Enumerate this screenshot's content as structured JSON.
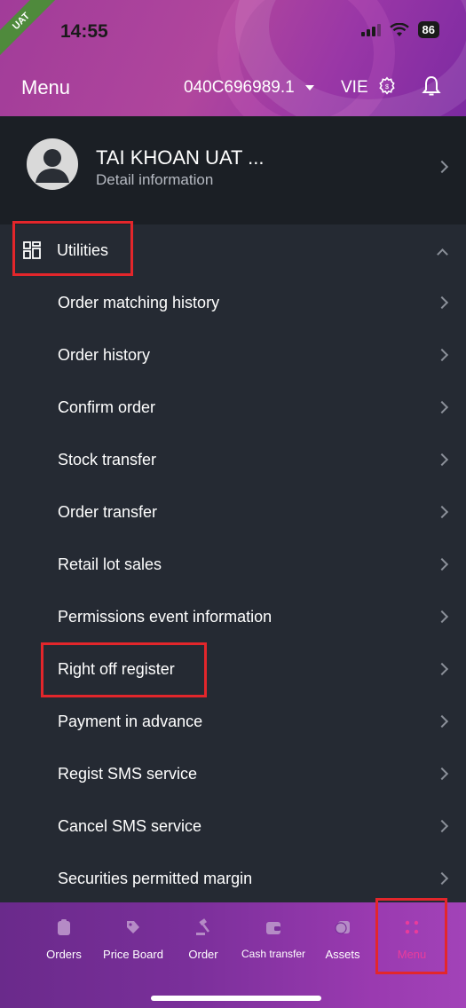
{
  "status_bar": {
    "time": "14:55",
    "battery": "86",
    "ribbon": "UAT"
  },
  "header": {
    "title": "Menu",
    "account": "040C696989.1",
    "language": "VIE"
  },
  "profile": {
    "name": "TAI KHOAN UAT ...",
    "subtitle": "Detail information"
  },
  "section": {
    "label": "Utilities"
  },
  "menu_items": [
    {
      "label": "Order matching history"
    },
    {
      "label": "Order history"
    },
    {
      "label": "Confirm order"
    },
    {
      "label": "Stock transfer"
    },
    {
      "label": "Order transfer"
    },
    {
      "label": "Retail lot sales"
    },
    {
      "label": "Permissions event information"
    },
    {
      "label": "Right off register"
    },
    {
      "label": "Payment in advance"
    },
    {
      "label": "Regist SMS service"
    },
    {
      "label": "Cancel SMS service"
    },
    {
      "label": "Securities permitted margin"
    }
  ],
  "bottom_nav": [
    {
      "label": "Orders",
      "icon": "clipboard-icon"
    },
    {
      "label": "Price Board",
      "icon": "tag-icon"
    },
    {
      "label": "Order",
      "icon": "gavel-icon"
    },
    {
      "label": "Cash transfer",
      "icon": "wallet-icon"
    },
    {
      "label": "Assets",
      "icon": "coins-icon"
    },
    {
      "label": "Menu",
      "icon": "grid-dots-icon",
      "active": true
    }
  ],
  "colors": {
    "accent": "#e93c9c",
    "highlight": "#e3262b",
    "background": "#252a33"
  }
}
